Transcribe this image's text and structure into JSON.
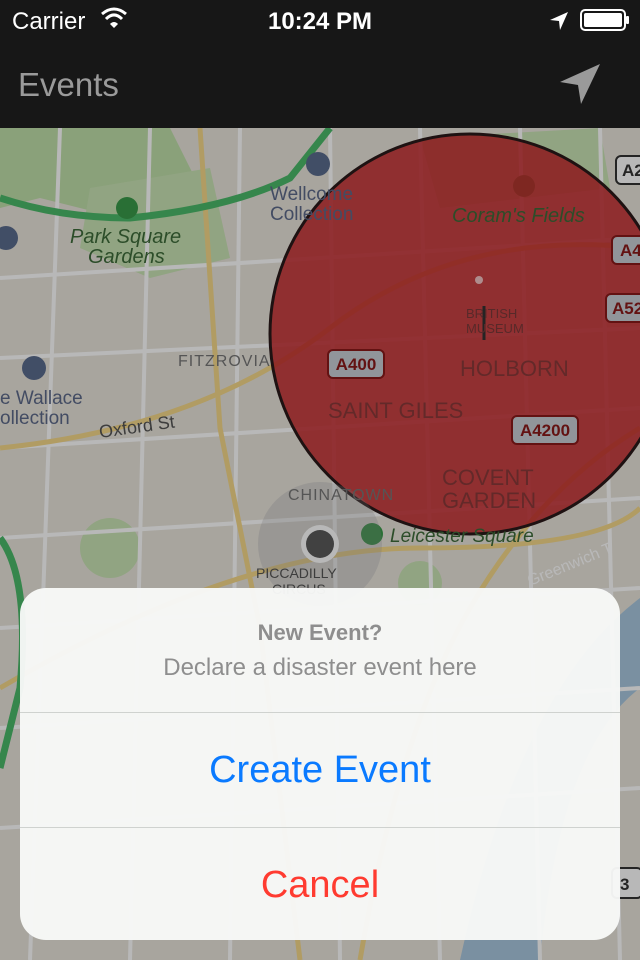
{
  "status_bar": {
    "carrier": "Carrier",
    "time": "10:24 PM"
  },
  "nav": {
    "title": "Events",
    "locate_icon": "location-arrow-icon"
  },
  "map": {
    "labels": {
      "wellcome": [
        "Wellcome",
        "Collection"
      ],
      "corams": "Coram's Fields",
      "park_square": [
        "Park Square",
        "Gardens"
      ],
      "fitzrovia": "FITZROVIA",
      "wallace": [
        "e Wallace",
        "ollection"
      ],
      "oxford": "Oxford St",
      "british_museum": [
        "BRITISH",
        "MUSEUM"
      ],
      "holborn": "HOLBORN",
      "saint_giles": "SAINT GILES",
      "covent": [
        "COVENT",
        "GARDEN"
      ],
      "chinatown": "CHINATOWN",
      "leicester": "Leicester Square",
      "piccadilly": [
        "PICCADILLY",
        "CIRCUS"
      ],
      "greenwich": "Greenwich T"
    },
    "road_shields": {
      "a400": "A400",
      "a4200": "A4200",
      "a52": "A52",
      "a4": "A4",
      "a2": "A2",
      "three": "3"
    },
    "event_area_color": "#c2262a"
  },
  "alert": {
    "title": "New Event?",
    "message": "Declare a disaster event here",
    "create_label": "Create Event",
    "cancel_label": "Cancel"
  }
}
